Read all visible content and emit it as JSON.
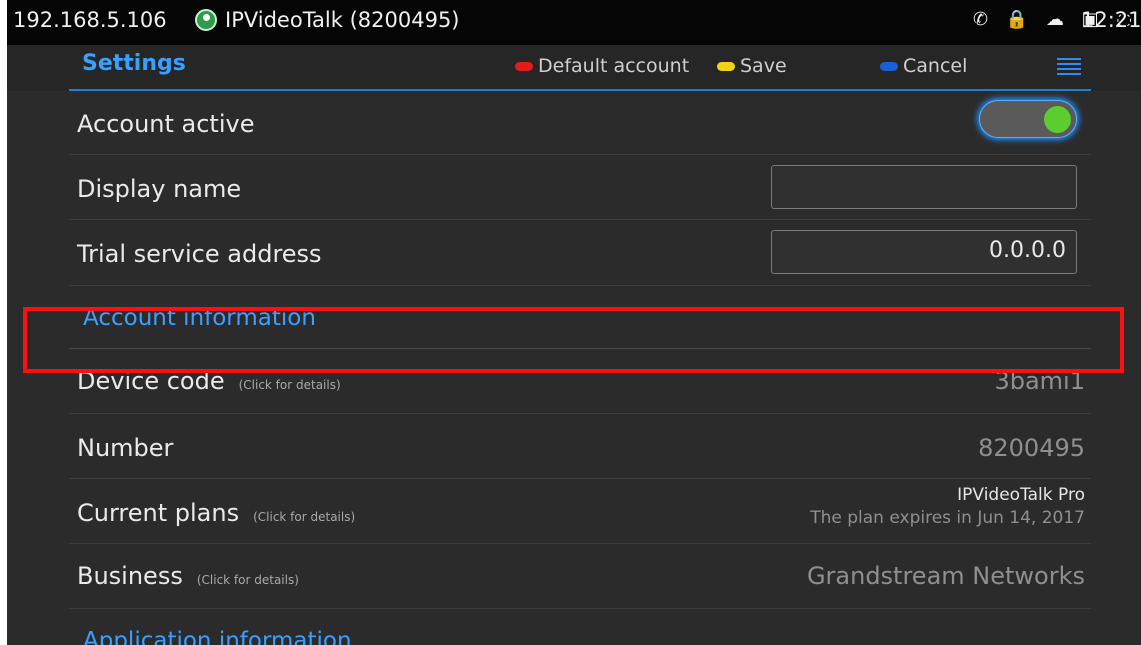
{
  "statusbar": {
    "ip": "192.168.5.106",
    "account": "IPVideoTalk (8200495)",
    "status_icons": "✆ 🔒 ☁ ▣ ◌",
    "time": "12:21"
  },
  "header": {
    "title": "Settings",
    "default_account_label": "Default account",
    "save_label": "Save",
    "cancel_label": "Cancel",
    "colors": {
      "red": "#e31b1b",
      "yellow": "#f2d31a",
      "blue": "#1a5fd6"
    }
  },
  "settings": {
    "account_active": {
      "label": "Account active",
      "enabled": true
    },
    "display_name": {
      "label": "Display name",
      "value": ""
    },
    "trial_service_address": {
      "label": "Trial service address",
      "value": "0.0.0.0"
    }
  },
  "account_information": {
    "title": "Account information",
    "device_code": {
      "label": "Device code",
      "hint": "(Click for details)",
      "value": "3bami1"
    },
    "number": {
      "label": "Number",
      "value": "8200495"
    },
    "current_plans": {
      "label": "Current plans",
      "hint": "(Click for details)",
      "plan": "IPVideoTalk Pro",
      "expiry": "The plan expires in Jun 14, 2017"
    },
    "business": {
      "label": "Business",
      "hint": "(Click for details)",
      "value": "Grandstream Networks"
    }
  },
  "application_information": {
    "title": "Application information"
  }
}
